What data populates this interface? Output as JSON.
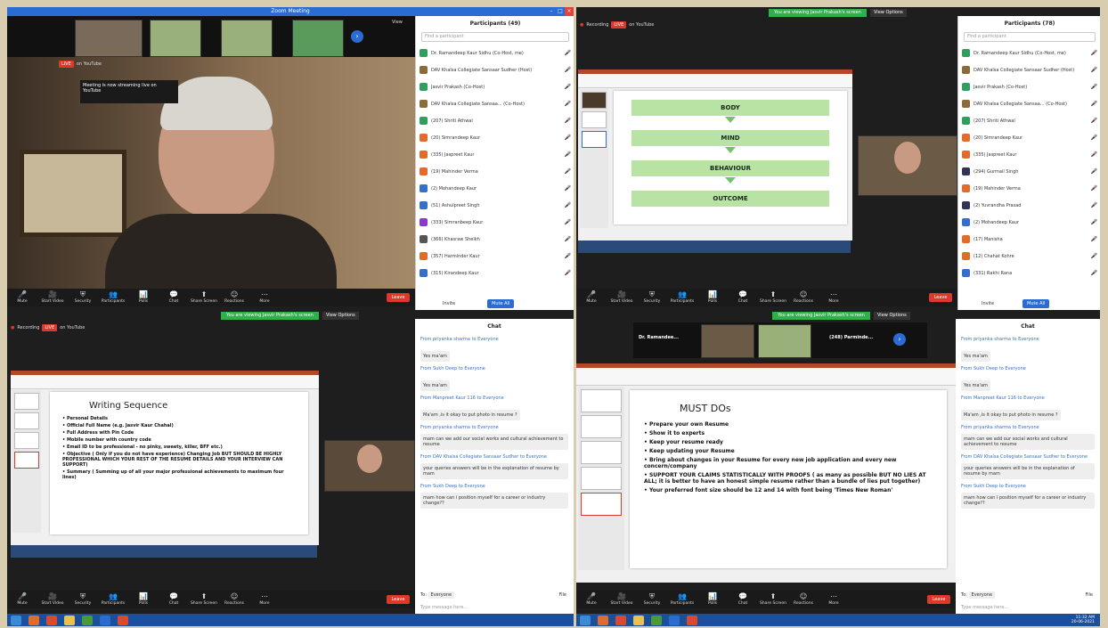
{
  "q1": {
    "window_title": "Zoom Meeting",
    "live_badge": "LIVE",
    "live_label": "on YouTube",
    "tooltip": "Meeting is now streaming live on YouTube",
    "view_label": "View",
    "panel_title": "Participants (49)",
    "search_placeholder": "Find a participant",
    "participants": [
      {
        "name": "Dr. Ramandeep Kaur Sidhu (Co-Host, me)",
        "color": "#2f9e5e"
      },
      {
        "name": "DAV Khalsa Collegiate Sansaar Sudher (Host)",
        "color": "#8a6b3a"
      },
      {
        "name": "Jasvir Prakash (Co-Host)",
        "color": "#2f9e5e"
      },
      {
        "name": "DAV Khalsa Collegiate Sansaa... (Co-Host)",
        "color": "#8a6b3a"
      },
      {
        "name": "(207) Shriti Athwal",
        "color": "#2f9e5e"
      },
      {
        "name": "(20) Simrandeep Kaur",
        "color": "#e06b2a"
      },
      {
        "name": "(335) Jaspreet Kaur",
        "color": "#e06b2a"
      },
      {
        "name": "(19) Mahinder Verma",
        "color": "#e06b2a"
      },
      {
        "name": "(2) Mohandeep Kaur",
        "color": "#3470c9"
      },
      {
        "name": "(51) Ashulpreet Singh",
        "color": "#3470c9"
      },
      {
        "name": "(333) Simranbeep Kaur",
        "color": "#8a3ac9"
      },
      {
        "name": "(366) Khasraw Sheikh",
        "color": "#555555"
      },
      {
        "name": "(357) Harminder Kaur",
        "color": "#e06b2a"
      },
      {
        "name": "(315) Kirandeep Kaur",
        "color": "#3470c9"
      }
    ],
    "invite_label": "Invite",
    "mute_all_label": "Mute All"
  },
  "q2": {
    "banner": "You are viewing Jasvir Prakash's screen",
    "view_options": "View Options",
    "recording": "Recording",
    "live_badge": "LIVE",
    "live_label": "on YouTube",
    "panel_title": "Participants (78)",
    "search_placeholder": "Find a participant",
    "participants": [
      {
        "name": "Dr. Ramandeep Kaur Sidhu (Co-Host, me)",
        "color": "#2f9e5e"
      },
      {
        "name": "DAV Khalsa Collegiate Sansaar Sudher (Host)",
        "color": "#8a6b3a"
      },
      {
        "name": "Jasvir Prakash (Co-Host)",
        "color": "#2f9e5e"
      },
      {
        "name": "DAV Khalsa Collegiate Sansaa... (Co-Host)",
        "color": "#8a6b3a"
      },
      {
        "name": "(207) Shriti Athwal",
        "color": "#2f9e5e"
      },
      {
        "name": "(20) Simrandeep Kaur",
        "color": "#e06b2a"
      },
      {
        "name": "(335) Jaspreet Kaur",
        "color": "#e06b2a"
      },
      {
        "name": "(294) Gurmail Singh",
        "color": "#333355"
      },
      {
        "name": "(19) Mahinder Verma",
        "color": "#e06b2a"
      },
      {
        "name": "(2) Yuvrandha Prasad",
        "color": "#333355"
      },
      {
        "name": "(2) Mohandeep Kaur",
        "color": "#3470c9"
      },
      {
        "name": "(17) Manisha",
        "color": "#e06b2a"
      },
      {
        "name": "(12) Chahat Kohre",
        "color": "#e06b2a"
      },
      {
        "name": "(331) Rakhi Rana",
        "color": "#3470c9"
      }
    ],
    "slide_steps": [
      "BODY",
      "MIND",
      "BEHAVIOUR",
      "OUTCOME"
    ],
    "invite_label": "Invite",
    "mute_all_label": "Mute All"
  },
  "q3": {
    "banner": "You are viewing Jasvir Prakash's screen",
    "view_options": "View Options",
    "recording": "Recording",
    "live_badge": "LIVE",
    "live_label": "on YouTube",
    "slide_title": "Writing Sequence",
    "slide_bullets": [
      "Personal Details",
      "Official Full Name (e.g. Jasvir Kaur Chahal)",
      "Full Address with Pin Code",
      "Mobile number with country code",
      "Email ID to be professional - no pinky, sweety, killer, BFF etc.)",
      "Objective ( Only if you do not have experience) Changing Job BUT SHOULD BE HIGHLY PROFESSIONAL WHICH YOUR REST OF THE RESUME DETAILS AND YOUR INTERVIEW CAN SUPPORT)",
      "Summary ( Summing up of all your major professional achievements to maximum four lines)"
    ],
    "chat_title": "Chat",
    "chat": [
      {
        "from": "From priyanka sharma to Everyone",
        "msg": "Yes ma'am"
      },
      {
        "from": "From Sukh Deep to Everyone",
        "msg": "Yes ma'am"
      },
      {
        "from": "From Manpreet Kaur 116 to Everyone",
        "msg": "Ma'am ,is it okay to put photo in resume ?"
      },
      {
        "from": "From priyanka sharma to Everyone",
        "msg": "mam can we add our social works and cultural achievement to resume"
      },
      {
        "from": "From DAV Khalsa Collegiate Sansaar Sudher to Everyone",
        "msg": "your queries answers will be in the explanation of resume by mam"
      },
      {
        "from": "From Sukh Deep to Everyone",
        "msg": "mam how can i position myself for a career or industry change??"
      }
    ],
    "to_label": "To:",
    "to_value": "Everyone",
    "file_label": "File",
    "type_placeholder": "Type message here..."
  },
  "q4": {
    "banner": "You are viewing Jasvir Prakash's screen",
    "view_options": "View Options",
    "tile1": "Dr. Ramandee...",
    "tile2": "(248) Parminde...",
    "slide_title": "MUST DOs",
    "slide_bullets": [
      "Prepare your own Resume",
      "Show it to experts",
      "Keep your resume ready",
      "Keep updating your Resume",
      "Bring about changes in your Resume for every new job application and every new concern/company",
      "SUPPORT YOUR CLAIMS STATISTICALLY WITH PROOFS ( as many as possible BUT NO LIES AT ALL; it is better to have an honest simple resume rather than a bundle of lies put together)",
      "Your preferred font size should be 12 and 14 with font being 'Times New Roman'"
    ],
    "chat_title": "Chat",
    "chat": [
      {
        "from": "From priyanka sharma to Everyone",
        "msg": "Yes ma'am"
      },
      {
        "from": "From Sukh Deep to Everyone",
        "msg": "Yes ma'am"
      },
      {
        "from": "From Manpreet Kaur 116 to Everyone",
        "msg": "Ma'am ,is it okay to put photo in resume ?"
      },
      {
        "from": "From priyanka sharma to Everyone",
        "msg": "mam can we add our social works and cultural achievement to resume"
      },
      {
        "from": "From DAV Khalsa Collegiate Sansaar Sudher to Everyone",
        "msg": "your queries answers will be in the explanation of resume by mam"
      },
      {
        "from": "From Sukh Deep to Everyone",
        "msg": "mam how can i position myself for a career or industry change??"
      }
    ],
    "to_label": "To:",
    "to_value": "Everyone",
    "file_label": "File",
    "type_placeholder": "Type message here..."
  },
  "toolbar": [
    {
      "label": "Mute",
      "icon": "mic-icon",
      "glyph": "🎤"
    },
    {
      "label": "Start Video",
      "icon": "video-icon",
      "glyph": "🎥"
    },
    {
      "label": "Security",
      "icon": "shield-icon",
      "glyph": "⛨"
    },
    {
      "label": "Participants",
      "icon": "participants-icon",
      "glyph": "👥"
    },
    {
      "label": "Polls",
      "icon": "polls-icon",
      "glyph": "📊"
    },
    {
      "label": "Chat",
      "icon": "chat-icon",
      "glyph": "💬"
    },
    {
      "label": "Share Screen",
      "icon": "share-icon",
      "glyph": "⬆"
    },
    {
      "label": "Reactions",
      "icon": "reactions-icon",
      "glyph": "☺"
    },
    {
      "label": "More",
      "icon": "more-icon",
      "glyph": "⋯"
    }
  ],
  "end_label": "Leave",
  "taskbar_time": "11:32 AM",
  "taskbar_date": "20-06-2021",
  "colors": {
    "zoom_blue": "#2b6cd4",
    "live_red": "#e0372c",
    "share_green": "#2fb14a",
    "taskbar": "#1a4f9c"
  }
}
